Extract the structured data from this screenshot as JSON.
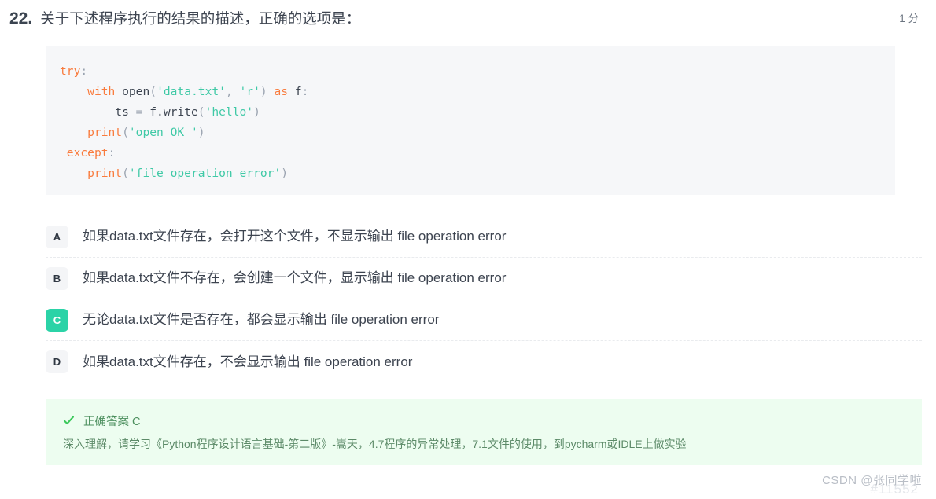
{
  "question": {
    "number": "22.",
    "text": "关于下述程序执行的结果的描述，正确的选项是：",
    "score": "1 分"
  },
  "code": {
    "language": "python",
    "lines": [
      [
        {
          "t": "try",
          "c": "kw"
        },
        {
          "t": ":",
          "c": "punct"
        }
      ],
      [
        {
          "t": "    ",
          "c": "plain"
        },
        {
          "t": "with",
          "c": "kw"
        },
        {
          "t": " ",
          "c": "plain"
        },
        {
          "t": "open",
          "c": "plain"
        },
        {
          "t": "(",
          "c": "punct"
        },
        {
          "t": "'data.txt'",
          "c": "str"
        },
        {
          "t": ",",
          "c": "punct"
        },
        {
          "t": " ",
          "c": "plain"
        },
        {
          "t": "'r'",
          "c": "str"
        },
        {
          "t": ")",
          "c": "punct"
        },
        {
          "t": " ",
          "c": "plain"
        },
        {
          "t": "as",
          "c": "kw"
        },
        {
          "t": " ",
          "c": "plain"
        },
        {
          "t": "f",
          "c": "plain"
        },
        {
          "t": ":",
          "c": "punct"
        }
      ],
      [
        {
          "t": "        ",
          "c": "plain"
        },
        {
          "t": "ts",
          "c": "plain"
        },
        {
          "t": " ",
          "c": "plain"
        },
        {
          "t": "=",
          "c": "op"
        },
        {
          "t": " ",
          "c": "plain"
        },
        {
          "t": "f.write",
          "c": "plain"
        },
        {
          "t": "(",
          "c": "punct"
        },
        {
          "t": "'hello'",
          "c": "str"
        },
        {
          "t": ")",
          "c": "punct"
        }
      ],
      [
        {
          "t": "    ",
          "c": "plain"
        },
        {
          "t": "print",
          "c": "fn"
        },
        {
          "t": "(",
          "c": "punct"
        },
        {
          "t": "'open OK '",
          "c": "str"
        },
        {
          "t": ")",
          "c": "punct"
        }
      ],
      [
        {
          "t": " ",
          "c": "plain"
        },
        {
          "t": "except",
          "c": "kw"
        },
        {
          "t": ":",
          "c": "punct"
        }
      ],
      [
        {
          "t": "    ",
          "c": "plain"
        },
        {
          "t": "print",
          "c": "fn"
        },
        {
          "t": "(",
          "c": "punct"
        },
        {
          "t": "'file operation error'",
          "c": "str"
        },
        {
          "t": ")",
          "c": "punct"
        }
      ]
    ]
  },
  "options": [
    {
      "key": "A",
      "text": "如果data.txt文件存在，会打开这个文件，不显示输出 file operation error",
      "selected": false
    },
    {
      "key": "B",
      "text": "如果data.txt文件不存在，会创建一个文件，显示输出 file operation error",
      "selected": false
    },
    {
      "key": "C",
      "text": "无论data.txt文件是否存在，都会显示输出 file operation error",
      "selected": true
    },
    {
      "key": "D",
      "text": "如果data.txt文件存在，不会显示输出 file operation error",
      "selected": false
    }
  ],
  "answer_panel": {
    "icon": "check-icon",
    "label": "正确答案 C",
    "explanation": "深入理解，请学习《Python程序设计语言基础-第二版》-嵩天，4.7程序的异常处理，7.1文件的使用，到pycharm或IDLE上做实验"
  },
  "watermark": {
    "text": "CSDN @张同学啦",
    "id": "#11552"
  },
  "colors": {
    "accent_selected": "#2bd3a7",
    "answer_panel_bg": "#edfdf0",
    "answer_text": "#4c8f5e",
    "code_bg": "#f6f7f9",
    "code_keyword": "#f97b3d",
    "code_string": "#3fc9a6",
    "code_punct": "#9aa3b0"
  }
}
